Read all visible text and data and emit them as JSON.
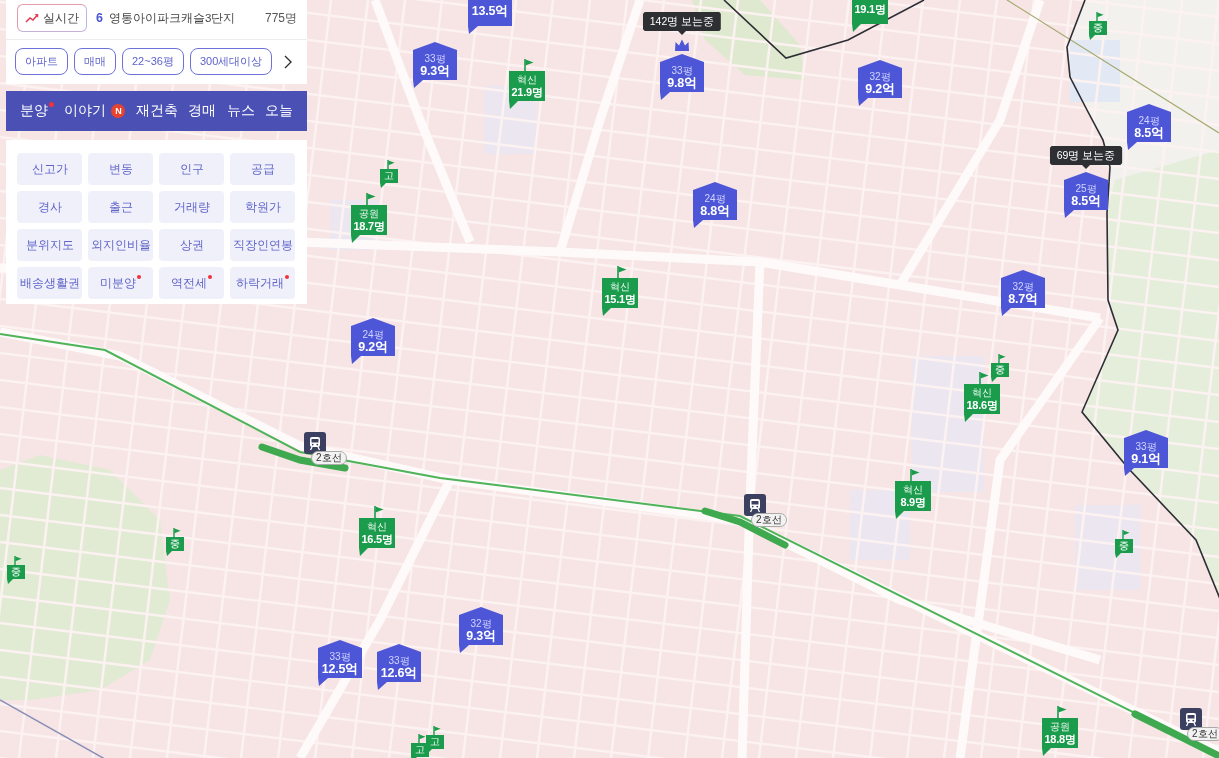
{
  "realtime": {
    "button": "실시간",
    "rank": "6",
    "name": "영통아이파크캐슬3단지",
    "count": "775명"
  },
  "filters": [
    "아파트",
    "매매",
    "22~36평",
    "300세대이상"
  ],
  "categories": [
    {
      "label": "분양",
      "dot": true
    },
    {
      "label": "이야기",
      "dot": false,
      "badge": "N"
    },
    {
      "label": "재건축",
      "dot": false
    },
    {
      "label": "경매",
      "dot": false
    },
    {
      "label": "뉴스",
      "dot": false
    },
    {
      "label": "오늘",
      "dot": false
    }
  ],
  "layers": [
    {
      "label": "신고가",
      "dot": false
    },
    {
      "label": "변동",
      "dot": false
    },
    {
      "label": "인구",
      "dot": false
    },
    {
      "label": "공급",
      "dot": false
    },
    {
      "label": "경사",
      "dot": false
    },
    {
      "label": "출근",
      "dot": false
    },
    {
      "label": "거래량",
      "dot": false
    },
    {
      "label": "학원가",
      "dot": false
    },
    {
      "label": "분위지도",
      "dot": false
    },
    {
      "label": "외지인비율",
      "dot": false
    },
    {
      "label": "상권",
      "dot": false
    },
    {
      "label": "직장인연봉",
      "dot": false
    },
    {
      "label": "배송생활권",
      "dot": false
    },
    {
      "label": "미분양",
      "dot": true
    },
    {
      "label": "역전세",
      "dot": true
    },
    {
      "label": "하락거래",
      "dot": true
    }
  ],
  "map": {
    "markers": [
      {
        "kind": "price",
        "price": "13.5억"
      },
      {
        "kind": "score",
        "value": "19.1명"
      },
      {
        "kind": "flag",
        "label": "중"
      },
      {
        "kind": "price",
        "size": "33평",
        "price": "9.3억"
      },
      {
        "kind": "score",
        "label": "혁신",
        "value": "21.9명"
      },
      {
        "kind": "crowned",
        "size": "33평",
        "price": "9.8억",
        "viewers": "142명 보는중"
      },
      {
        "kind": "price",
        "size": "32평",
        "price": "9.2억"
      },
      {
        "kind": "price",
        "size": "24평",
        "price": "8.5억"
      },
      {
        "kind": "score",
        "label": "공원",
        "value": "18.7명"
      },
      {
        "kind": "flag",
        "label": "고"
      },
      {
        "kind": "price",
        "size": "24평",
        "price": "8.8억"
      },
      {
        "kind": "price",
        "size": "25평",
        "price": "8.5억",
        "viewers": "69명 보는중"
      },
      {
        "kind": "score",
        "label": "혁신",
        "value": "15.1명"
      },
      {
        "kind": "price",
        "size": "32평",
        "price": "8.7억"
      },
      {
        "kind": "price",
        "size": "24평",
        "price": "9.2억"
      },
      {
        "kind": "score",
        "label": "혁신",
        "value": "18.6명"
      },
      {
        "kind": "flag",
        "label": "중"
      },
      {
        "kind": "station",
        "line": "2호선"
      },
      {
        "kind": "price",
        "size": "33평",
        "price": "9.1억"
      },
      {
        "kind": "station",
        "line": "2호선"
      },
      {
        "kind": "score",
        "label": "혁신",
        "value": "8.9명"
      },
      {
        "kind": "flag",
        "label": "중"
      },
      {
        "kind": "score",
        "label": "혁신",
        "value": "16.5명"
      },
      {
        "kind": "flag",
        "label": "중"
      },
      {
        "kind": "flag",
        "label": "중"
      },
      {
        "kind": "price",
        "size": "32평",
        "price": "9.3억"
      },
      {
        "kind": "price",
        "size": "33평",
        "price": "12.5억"
      },
      {
        "kind": "price",
        "size": "33평",
        "price": "12.6억"
      },
      {
        "kind": "score",
        "label": "공원",
        "value": "18.8명"
      },
      {
        "kind": "station",
        "line": "2호선"
      },
      {
        "kind": "flag",
        "label": "고"
      },
      {
        "kind": "flag",
        "label": "고"
      }
    ]
  }
}
